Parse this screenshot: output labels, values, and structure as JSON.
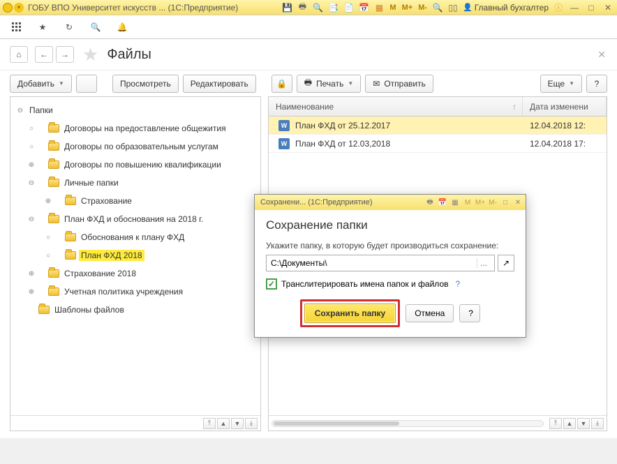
{
  "titlebar": {
    "title": "ГОБУ ВПО Университет искусств ...  (1С:Предприятие)",
    "m": "M",
    "mplus": "M+",
    "mminus": "M-",
    "user": "Главный бухгалтер"
  },
  "page": {
    "title": "Файлы"
  },
  "toolbar": {
    "add": "Добавить",
    "view": "Просмотреть",
    "edit": "Редактировать",
    "print": "Печать",
    "send": "Отправить",
    "more": "Еще",
    "help": "?"
  },
  "tree": {
    "root": "Папки",
    "items": [
      {
        "label": "Договоры на предоставление общежития",
        "indent": 1,
        "exp": "○",
        "hl": false
      },
      {
        "label": "Договоры по образовательным услугам",
        "indent": 1,
        "exp": "○",
        "hl": false
      },
      {
        "label": "Договоры по повышению квалификации",
        "indent": 1,
        "exp": "⊕",
        "hl": false
      },
      {
        "label": "Личные папки",
        "indent": 1,
        "exp": "⊖",
        "hl": false
      },
      {
        "label": "Страхование",
        "indent": 2,
        "exp": "⊕",
        "hl": false
      },
      {
        "label": "План ФХД и обоснования на 2018 г.",
        "indent": 1,
        "exp": "⊖",
        "hl": false
      },
      {
        "label": "Обоснования к плану ФХД",
        "indent": 2,
        "exp": "○",
        "hl": false
      },
      {
        "label": "План ФХД 2018",
        "indent": 2,
        "exp": "○",
        "hl": true
      },
      {
        "label": "Страхование 2018",
        "indent": 1,
        "exp": "⊕",
        "hl": false
      },
      {
        "label": "Учетная политика учреждения",
        "indent": 1,
        "exp": "⊕",
        "hl": false
      },
      {
        "label": "Шаблоны файлов",
        "indent": 1,
        "exp": "",
        "hl": false
      }
    ]
  },
  "list": {
    "col_name": "Наименование",
    "col_date": "Дата изменени",
    "rows": [
      {
        "name": "План ФХД от 25.12.2017",
        "date": "12.04.2018 12:",
        "selected": true
      },
      {
        "name": "План ФХД от 12.03,2018",
        "date": "12.04.2018 17:",
        "selected": false
      }
    ]
  },
  "modal": {
    "titlebar": "Сохранени...  (1С:Предприятие)",
    "m": "M",
    "mplus": "M+",
    "mminus": "M-",
    "heading": "Сохранение папки",
    "label": "Укажите папку, в которую будет производиться сохранение:",
    "path": "C:\\Документы\\",
    "dots": "...",
    "translit": "Транслитерировать имена папок и файлов",
    "q": "?",
    "save": "Сохранить папку",
    "cancel": "Отмена",
    "help": "?"
  }
}
